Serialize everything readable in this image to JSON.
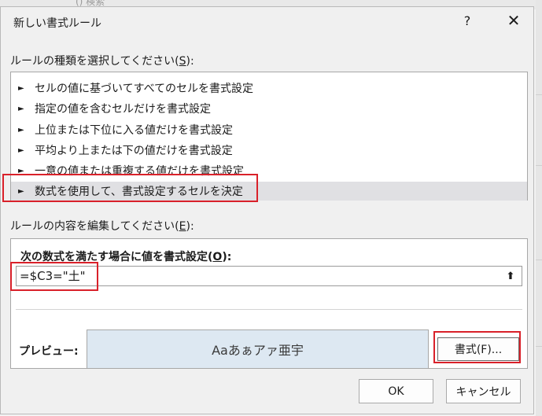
{
  "background": {
    "ghost_text": "() 検索"
  },
  "dialog": {
    "title": "新しい書式ルール",
    "help_glyph": "?",
    "close_glyph": "✕"
  },
  "rule_type": {
    "label_prefix": "ルールの種類を選択してください(",
    "label_key": "S",
    "label_suffix": "):",
    "items": [
      "セルの値に基づいてすべてのセルを書式設定",
      "指定の値を含むセルだけを書式設定",
      "上位または下位に入る値だけを書式設定",
      "平均より上または下の値だけを書式設定",
      "一意の値または重複する値だけを書式設定",
      "数式を使用して、書式設定するセルを決定"
    ],
    "selected_index": 5,
    "arrow_glyph": "►"
  },
  "rule_edit": {
    "label_prefix": "ルールの内容を編集してください(",
    "label_key": "E",
    "label_suffix": "):",
    "formula_label_prefix": "次の数式を満たす場合に値を書式設定(",
    "formula_label_key": "O",
    "formula_label_suffix": "):",
    "formula_value": "=$C3=\"土\"",
    "collapse_glyph": "⬆",
    "preview_label": "プレビュー:",
    "preview_text": "Aaあぁアァ亜宇",
    "format_button": "書式(F)..."
  },
  "buttons": {
    "ok": "OK",
    "cancel": "キャンセル"
  },
  "colors": {
    "highlight": "#d9212a",
    "preview_bg": "#dde8f2",
    "selected_row": "#e0e0e3"
  }
}
